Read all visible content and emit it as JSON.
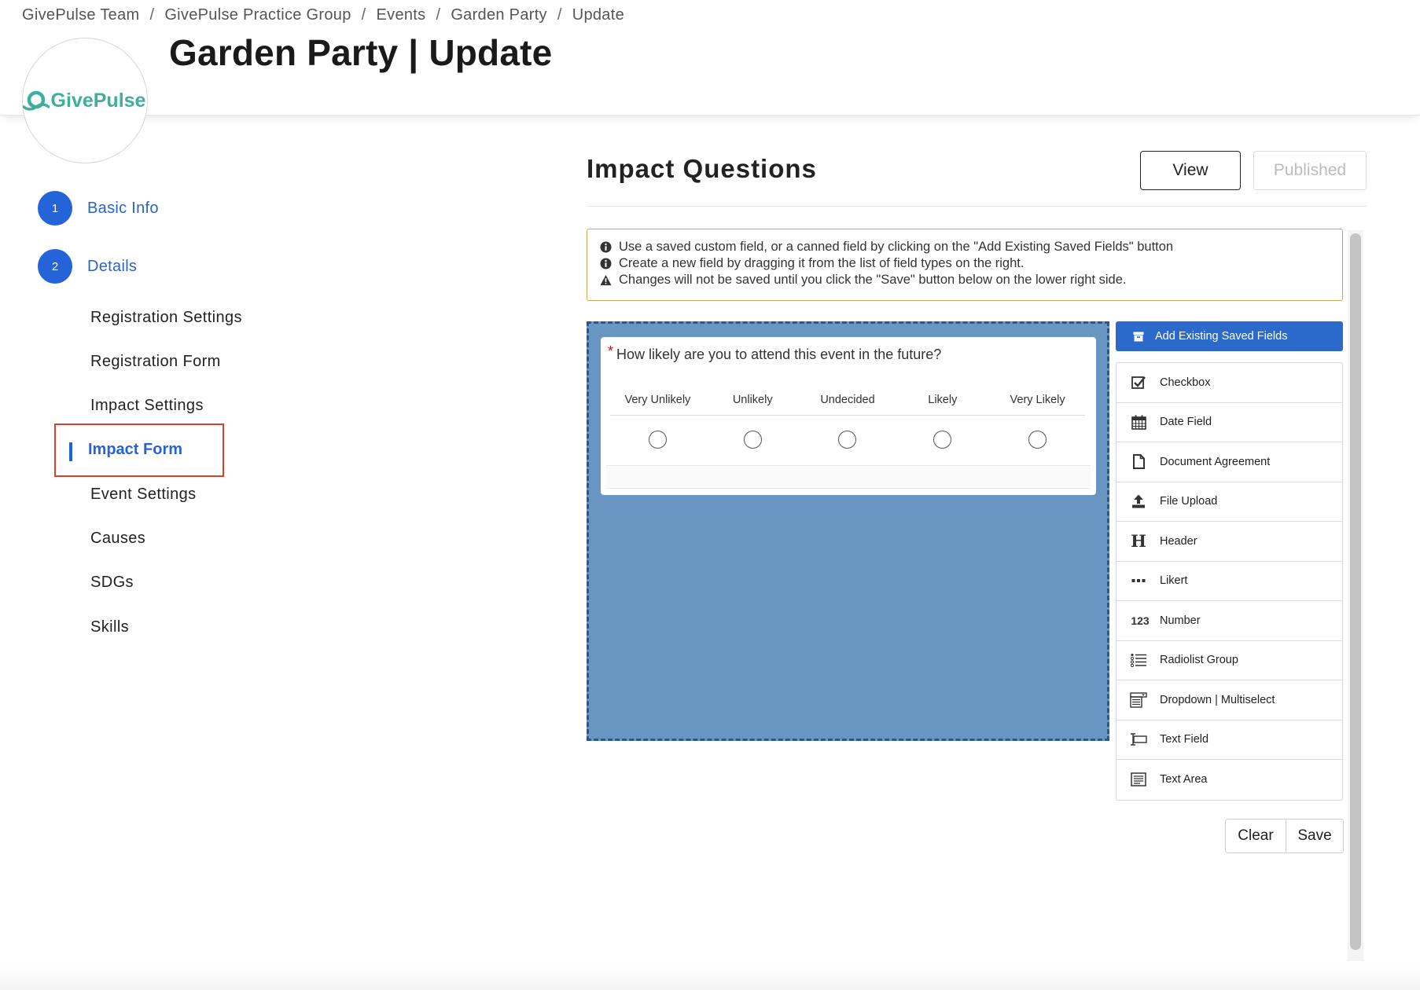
{
  "breadcrumb": [
    "GivePulse Team",
    "GivePulse Practice Group",
    "Events",
    "Garden Party",
    "Update"
  ],
  "breadcrumb_separator": "/",
  "page_title": "Garden Party | Update",
  "logo": {
    "text": "GivePulse",
    "color": "#3fae9a"
  },
  "steps": [
    {
      "number": "1",
      "label": "Basic Info"
    },
    {
      "number": "2",
      "label": "Details"
    }
  ],
  "sub_nav": [
    "Registration Settings",
    "Registration Form",
    "Impact Settings",
    "Impact Form",
    "Event Settings",
    "Causes",
    "SDGs",
    "Skills"
  ],
  "active_sub_nav": "Impact Form",
  "section": {
    "title": "Impact Questions",
    "view_label": "View",
    "published_label": "Published"
  },
  "notice": [
    {
      "icon": "info-icon",
      "text": "Use a saved custom field, or a canned field by clicking on the \"Add Existing Saved Fields\" button"
    },
    {
      "icon": "info-icon",
      "text": "Create a new field by dragging it from the list of field types on the right."
    },
    {
      "icon": "warning-icon",
      "text": "Changes will not be saved until you click the \"Save\" button below on the lower right side."
    }
  ],
  "question": {
    "required_mark": "*",
    "text": "How likely are you to attend this event in the future?",
    "options": [
      "Very Unlikely",
      "Unlikely",
      "Undecided",
      "Likely",
      "Very Likely"
    ]
  },
  "add_existing_label": "Add Existing Saved Fields",
  "field_types": [
    {
      "icon": "checkbox-icon",
      "label": "Checkbox"
    },
    {
      "icon": "calendar-icon",
      "label": "Date Field"
    },
    {
      "icon": "document-icon",
      "label": "Document Agreement"
    },
    {
      "icon": "upload-icon",
      "label": "File Upload"
    },
    {
      "icon": "header-icon",
      "label": "Header"
    },
    {
      "icon": "ellipsis-icon",
      "label": "Likert"
    },
    {
      "icon": "number-icon",
      "label": "Number"
    },
    {
      "icon": "list-icon",
      "label": "Radiolist Group"
    },
    {
      "icon": "dropdown-icon",
      "label": "Dropdown | Multiselect"
    },
    {
      "icon": "textfield-icon",
      "label": "Text Field"
    },
    {
      "icon": "textarea-icon",
      "label": "Text Area"
    }
  ],
  "number_icon_text": "123",
  "header_icon_text": "H",
  "actions": {
    "clear_label": "Clear",
    "save_label": "Save"
  },
  "colors": {
    "accent": "#2563d9",
    "dropzone": "#6895c2",
    "highlight_border": "#d6402c",
    "notice_border": "#d4a556"
  }
}
